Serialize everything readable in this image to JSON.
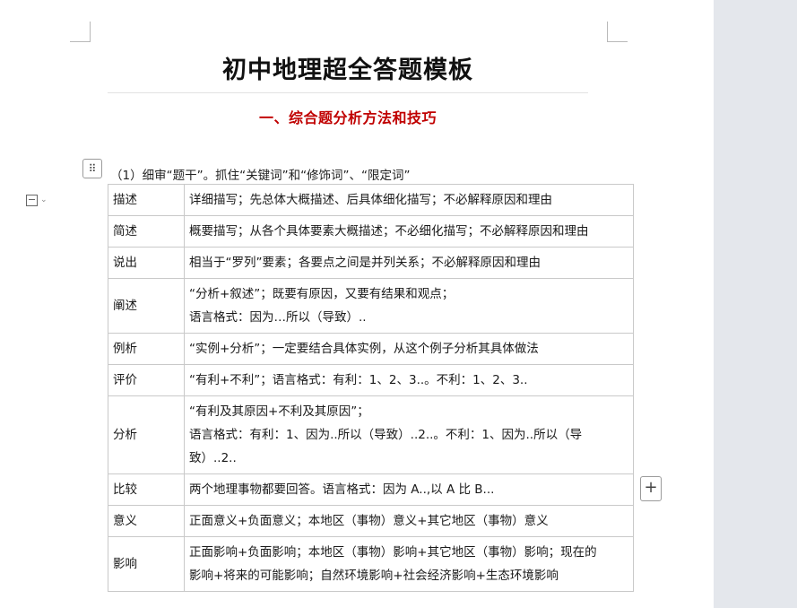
{
  "document": {
    "title": "初中地理超全答题模板",
    "section_heading": "一、综合题分析方法和技巧",
    "intro": "（1）细审“题干”。抓住“关键词”和“修饰词”、“限定词”"
  },
  "table": {
    "rows": [
      {
        "term": "描述",
        "lines": [
          "详细描写；先总体大概描述、后具体细化描写；不必解释原因和理由"
        ]
      },
      {
        "term": "简述",
        "lines": [
          "概要描写；从各个具体要素大概描述；不必细化描写；不必解释原因和理由"
        ]
      },
      {
        "term": "说出",
        "lines": [
          "相当于“罗列”要素；各要点之间是并列关系；不必解释原因和理由"
        ]
      },
      {
        "term": "阐述",
        "lines": [
          "“分析+叙述”；既要有原因，又要有结果和观点；",
          "语言格式：因为…所以（导致）.."
        ]
      },
      {
        "term": "例析",
        "lines": [
          "“实例+分析”；一定要结合具体实例，从这个例子分析其具体做法"
        ]
      },
      {
        "term": "评价",
        "lines": [
          "“有利+不利”；语言格式：有利：1、2、3..。不利：1、2、3.."
        ]
      },
      {
        "term": "分析",
        "lines": [
          "“有利及其原因+不利及其原因”；",
          "语言格式：有利：1、因为..所以（导致）..2..。不利：1、因为..所以（导",
          "致）..2.."
        ]
      },
      {
        "term": "比较",
        "lines": [
          "两个地理事物都要回答。语言格式：因为 A..,以 A 比 B..."
        ]
      },
      {
        "term": "意义",
        "lines": [
          "正面意义+负面意义；本地区（事物）意义+其它地区（事物）意义"
        ]
      },
      {
        "term": "影响",
        "lines": [
          "正面影响+负面影响；本地区（事物）影响+其它地区（事物）影响；现在的",
          "影响+将来的可能影响；自然环境影响+社会经济影响+生态环境影响"
        ]
      }
    ]
  },
  "controls": {
    "table_handle_icon": "⠿",
    "add_column_icon": "+"
  }
}
